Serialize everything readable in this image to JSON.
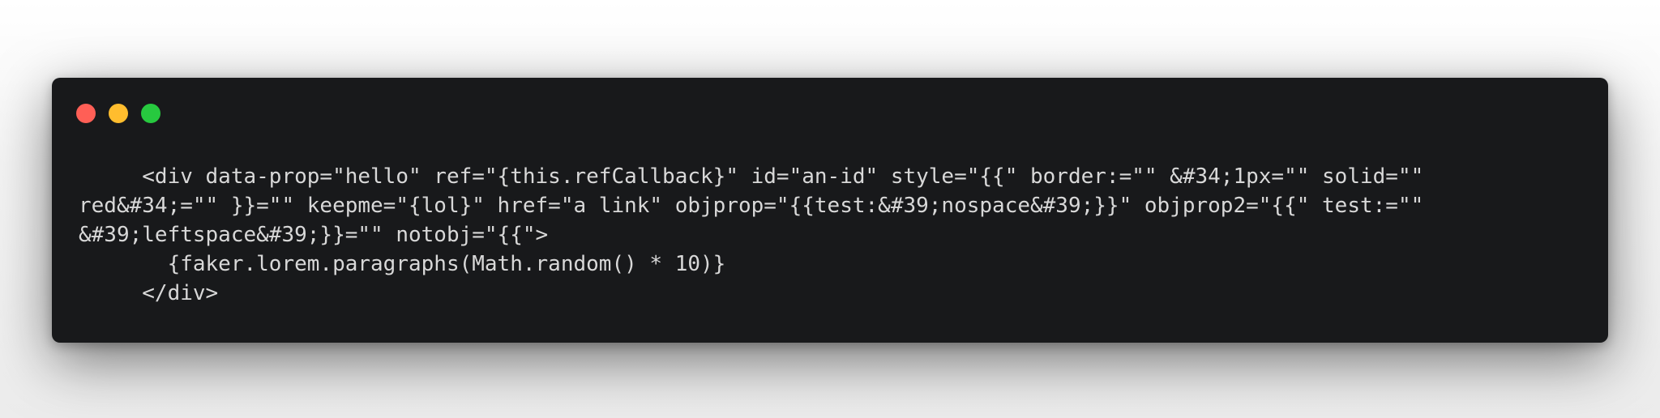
{
  "window": {
    "background": "#18191b",
    "text_color": "#d8d8d8",
    "controls": {
      "close_color": "#ff5f56",
      "minimize_color": "#ffbd2e",
      "maximize_color": "#27c93f"
    }
  },
  "code": {
    "lines": [
      "     <div data-prop=\"hello\" ref=\"{this.refCallback}\" id=\"an-id\" style=\"{{\" border:=\"\" &#34;1px=\"\" solid=\"\"",
      "red&#34;=\"\" }}=\"\" keepme=\"{lol}\" href=\"a link\" objprop=\"{{test:&#39;nospace&#39;}}\" objprop2=\"{{\" test:=\"\"",
      "&#39;leftspace&#39;}}=\"\" notobj=\"{{\">",
      "       {faker.lorem.paragraphs(Math.random() * 10)}",
      "     </div>"
    ]
  }
}
